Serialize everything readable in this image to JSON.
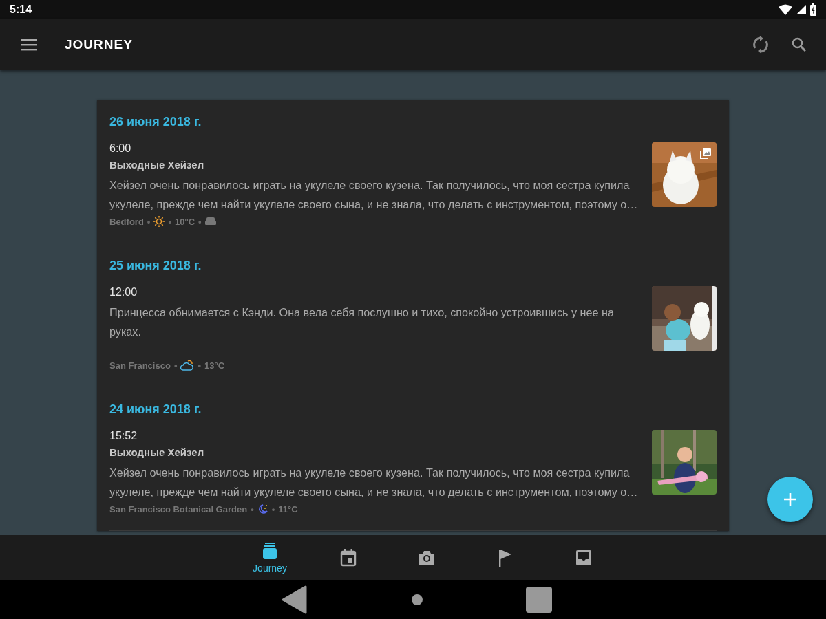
{
  "status_bar": {
    "time": "5:14"
  },
  "app_bar": {
    "title": "JOURNEY"
  },
  "entries": [
    {
      "date": "26 июня 2018 г.",
      "time": "6:00",
      "title": "Выходные Хейзел",
      "text": "Хейзел очень понравилось играть на укулеле своего кузена. Так получилось, что моя сестра купила укулеле, прежде чем найти укулеле своего сына, и не знала, что делать с инструментом, поэтому о…",
      "meta": [
        {
          "kind": "text",
          "text": "Bedford"
        },
        {
          "kind": "separator",
          "text": "•"
        },
        {
          "kind": "sun"
        },
        {
          "kind": "separator",
          "text": "•"
        },
        {
          "kind": "text",
          "text": "10°C"
        },
        {
          "kind": "separator",
          "text": "•"
        },
        {
          "kind": "sofa"
        }
      ],
      "multiple_photos": true
    },
    {
      "date": "25 июня 2018 г.",
      "time": "12:00",
      "text": "Принцесса обнимается с Кэнди. Она вела себя послушно и тихо, спокойно устроившись у нее на руках.",
      "meta": [
        {
          "kind": "text",
          "text": "San Francisco"
        },
        {
          "kind": "separator",
          "text": "•"
        },
        {
          "kind": "cloud-sun"
        },
        {
          "kind": "separator",
          "text": "•"
        },
        {
          "kind": "text",
          "text": "13°C"
        }
      ],
      "multiple_photos": false
    },
    {
      "date": "24 июня 2018 г.",
      "time": "15:52",
      "title": "Выходные Хейзел",
      "text": "Хейзел очень понравилось играть на укулеле своего кузена. Так получилось, что моя сестра купила укулеле, прежде чем найти укулеле своего сына, и не знала, что делать с инструментом, поэтому о…",
      "meta": [
        {
          "kind": "text",
          "text": "San Francisco Botanical Garden"
        },
        {
          "kind": "separator",
          "text": "•"
        },
        {
          "kind": "moon"
        },
        {
          "kind": "separator",
          "text": "•"
        },
        {
          "kind": "text",
          "text": "11°C"
        }
      ],
      "multiple_photos": false
    }
  ],
  "bottom_nav": [
    {
      "kind": "journey",
      "label": "Journey",
      "selected": true
    },
    {
      "kind": "calendar",
      "selected": false
    },
    {
      "kind": "camera",
      "selected": false
    },
    {
      "kind": "flag",
      "selected": false
    },
    {
      "kind": "inbox",
      "selected": false
    }
  ]
}
